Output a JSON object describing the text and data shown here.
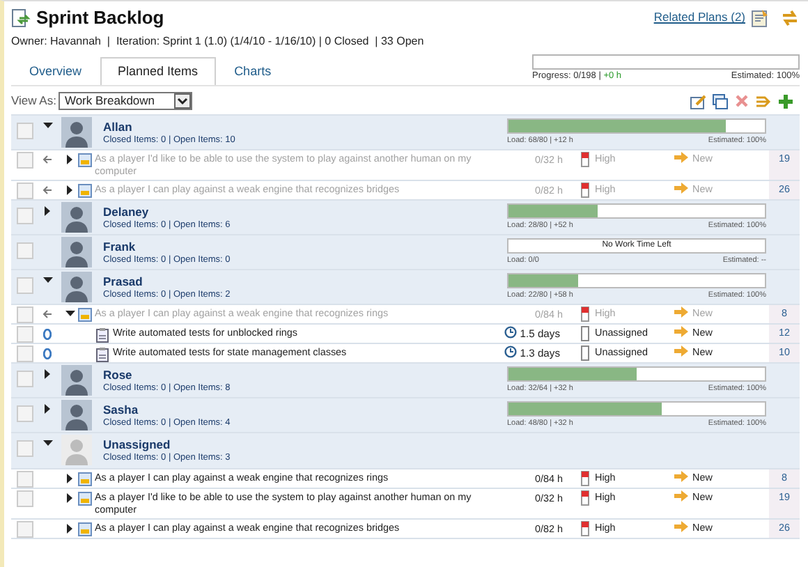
{
  "header": {
    "title": "Sprint Backlog",
    "related_plans": "Related Plans (2)",
    "owner_line": "Owner: Havannah  |  Iteration: Sprint 1 (1.0) (1/4/10 - 1/16/10) | 0 Closed  | 33 Open"
  },
  "progress": {
    "level": 0,
    "label": "Progress: 0/198 | ",
    "delta": "+0 h",
    "estimated": "Estimated: 100%"
  },
  "tabs": [
    {
      "label": "Overview",
      "selected": false
    },
    {
      "label": "Planned Items",
      "selected": true
    },
    {
      "label": "Charts",
      "selected": false
    }
  ],
  "view_as": {
    "label": "View As:",
    "value": "Work Breakdown"
  },
  "rows": [
    {
      "kind": "owner",
      "checked": false,
      "name": "Allan",
      "counts": "Closed Items: 0 | Open Items: 10",
      "expanded": true,
      "level": 0.85,
      "load": "Load: 68/80 | +12 h",
      "estimated": "Estimated: 100%"
    },
    {
      "kind": "item",
      "checked": false,
      "text": "As a player I'd like to be able to use the system to play against another human on my computer",
      "dimmed": true,
      "linked": true,
      "expanded": false,
      "effort": "0/32 h",
      "priority": "High",
      "status": "New",
      "id": "19"
    },
    {
      "kind": "item",
      "checked": false,
      "text": "As a player I can play against a weak engine that recognizes bridges",
      "dimmed": true,
      "linked": true,
      "expanded": false,
      "effort": "0/82 h",
      "priority": "High",
      "status": "New",
      "id": "26"
    },
    {
      "kind": "owner",
      "checked": false,
      "name": "Delaney",
      "counts": "Closed Items: 0 | Open Items: 6",
      "expanded": false,
      "level": 0.35,
      "load": "Load: 28/80 | +52 h",
      "estimated": "Estimated: 100%"
    },
    {
      "kind": "owner",
      "checked": false,
      "name": "Frank",
      "counts": "Closed Items: 0 | Open Items: 0",
      "level": 0,
      "bar_text": "No Work Time Left",
      "load": "Load: 0/0",
      "estimated": "Estimated: --"
    },
    {
      "kind": "owner",
      "checked": false,
      "name": "Prasad",
      "counts": "Closed Items: 0 | Open Items: 2",
      "expanded": true,
      "level": 0.27,
      "load": "Load: 22/80 | +58 h",
      "estimated": "Estimated: 100%"
    },
    {
      "kind": "item",
      "checked": false,
      "text": "As a player I can play against a weak engine that recognizes rings",
      "dimmed": true,
      "linked": true,
      "expanded": true,
      "effort": "0/84 h",
      "priority": "High",
      "status": "New",
      "id": "8"
    },
    {
      "kind": "task",
      "checked": false,
      "text": "Write automated tests for unblocked rings",
      "effort": "1.5 days",
      "priority": "Unassigned",
      "status": "New",
      "id": "12"
    },
    {
      "kind": "task",
      "checked": false,
      "text": "Write automated tests for state management classes",
      "effort": "1.3 days",
      "priority": "Unassigned",
      "status": "New",
      "id": "10"
    },
    {
      "kind": "owner",
      "checked": false,
      "name": "Rose",
      "counts": "Closed Items: 0 | Open Items: 8",
      "expanded": false,
      "level": 0.5,
      "load": "Load: 32/64 | +32 h",
      "estimated": "Estimated: 100%"
    },
    {
      "kind": "owner",
      "checked": false,
      "name": "Sasha",
      "counts": "Closed Items: 0 | Open Items: 4",
      "expanded": false,
      "level": 0.6,
      "load": "Load: 48/80 | +32 h",
      "estimated": "Estimated: 100%"
    },
    {
      "kind": "owner",
      "checked": false,
      "name": "Unassigned",
      "counts": "Closed Items: 0 | Open Items: 3",
      "expanded": true,
      "unassigned": true
    },
    {
      "kind": "item",
      "checked": false,
      "text": "As a player I can play against a weak engine that recognizes rings",
      "dimmed": false,
      "linked": false,
      "expanded": false,
      "effort": "0/84 h",
      "priority": "High",
      "status": "New",
      "id": "8"
    },
    {
      "kind": "item",
      "checked": false,
      "text": "As a player I'd like to be able to use the system to play against another human on my computer",
      "dimmed": false,
      "linked": false,
      "expanded": false,
      "effort": "0/32 h",
      "priority": "High",
      "status": "New",
      "id": "19"
    },
    {
      "kind": "item",
      "checked": false,
      "text": "As a player I can play against a weak engine that recognizes bridges",
      "dimmed": false,
      "linked": false,
      "expanded": false,
      "effort": "0/82 h",
      "priority": "High",
      "status": "New",
      "id": "26"
    }
  ]
}
